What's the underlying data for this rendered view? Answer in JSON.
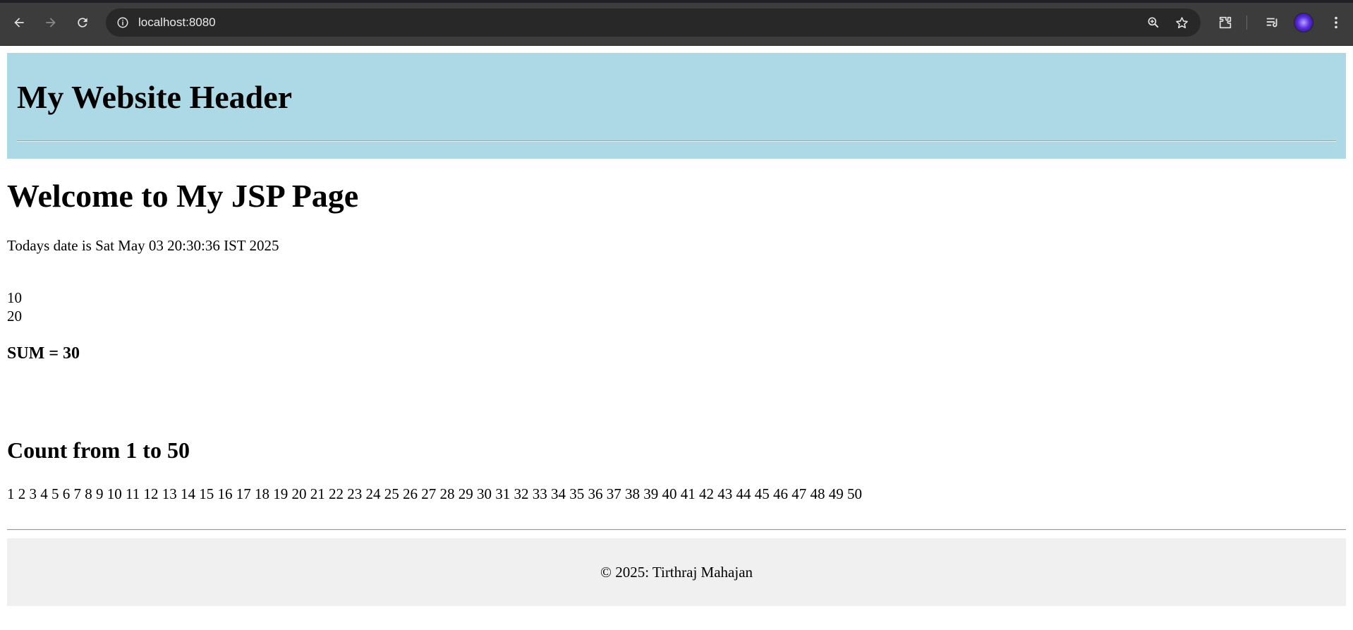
{
  "browser": {
    "url": "localhost:8080",
    "icons": [
      "back-icon",
      "forward-icon",
      "reload-icon",
      "site-info-icon",
      "zoom-icon",
      "bookmark-star-icon",
      "extensions-icon",
      "media-control-icon",
      "profile-avatar",
      "menu-kebab-icon"
    ]
  },
  "header": {
    "title": "My Website Header"
  },
  "main": {
    "heading": "Welcome to My JSP Page",
    "date_line": "Todays date is Sat May 03 20:30:36 IST 2025",
    "number_a": "10",
    "number_b": "20",
    "sum": "SUM = 30",
    "count_heading": "Count from 1 to 50",
    "count_values": "1 2 3 4 5 6 7 8 9 10 11 12 13 14 15 16 17 18 19 20 21 22 23 24 25 26 27 28 29 30 31 32 33 34 35 36 37 38 39 40 41 42 43 44 45 46 47 48 49 50"
  },
  "footer": {
    "text": "© 2025: Tirthraj Mahajan"
  },
  "colors": {
    "header_bg": "#add8e6",
    "footer_bg": "#f0f0f0",
    "chrome_bg": "#3c3c3c"
  }
}
